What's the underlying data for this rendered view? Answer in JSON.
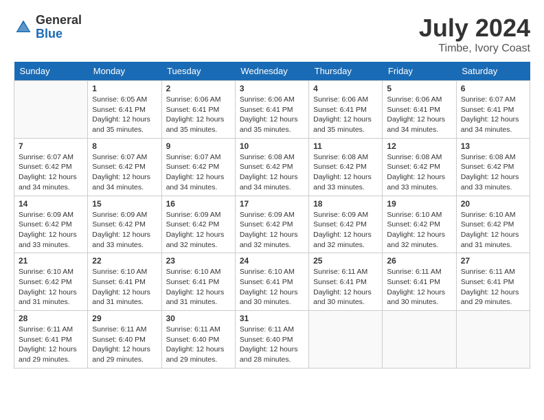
{
  "logo": {
    "general": "General",
    "blue": "Blue"
  },
  "title": {
    "month_year": "July 2024",
    "location": "Timbe, Ivory Coast"
  },
  "days_header": [
    "Sunday",
    "Monday",
    "Tuesday",
    "Wednesday",
    "Thursday",
    "Friday",
    "Saturday"
  ],
  "weeks": [
    [
      {
        "num": "",
        "info": ""
      },
      {
        "num": "1",
        "info": "Sunrise: 6:05 AM\nSunset: 6:41 PM\nDaylight: 12 hours\nand 35 minutes."
      },
      {
        "num": "2",
        "info": "Sunrise: 6:06 AM\nSunset: 6:41 PM\nDaylight: 12 hours\nand 35 minutes."
      },
      {
        "num": "3",
        "info": "Sunrise: 6:06 AM\nSunset: 6:41 PM\nDaylight: 12 hours\nand 35 minutes."
      },
      {
        "num": "4",
        "info": "Sunrise: 6:06 AM\nSunset: 6:41 PM\nDaylight: 12 hours\nand 35 minutes."
      },
      {
        "num": "5",
        "info": "Sunrise: 6:06 AM\nSunset: 6:41 PM\nDaylight: 12 hours\nand 34 minutes."
      },
      {
        "num": "6",
        "info": "Sunrise: 6:07 AM\nSunset: 6:41 PM\nDaylight: 12 hours\nand 34 minutes."
      }
    ],
    [
      {
        "num": "7",
        "info": "Sunrise: 6:07 AM\nSunset: 6:42 PM\nDaylight: 12 hours\nand 34 minutes."
      },
      {
        "num": "8",
        "info": "Sunrise: 6:07 AM\nSunset: 6:42 PM\nDaylight: 12 hours\nand 34 minutes."
      },
      {
        "num": "9",
        "info": "Sunrise: 6:07 AM\nSunset: 6:42 PM\nDaylight: 12 hours\nand 34 minutes."
      },
      {
        "num": "10",
        "info": "Sunrise: 6:08 AM\nSunset: 6:42 PM\nDaylight: 12 hours\nand 34 minutes."
      },
      {
        "num": "11",
        "info": "Sunrise: 6:08 AM\nSunset: 6:42 PM\nDaylight: 12 hours\nand 33 minutes."
      },
      {
        "num": "12",
        "info": "Sunrise: 6:08 AM\nSunset: 6:42 PM\nDaylight: 12 hours\nand 33 minutes."
      },
      {
        "num": "13",
        "info": "Sunrise: 6:08 AM\nSunset: 6:42 PM\nDaylight: 12 hours\nand 33 minutes."
      }
    ],
    [
      {
        "num": "14",
        "info": "Sunrise: 6:09 AM\nSunset: 6:42 PM\nDaylight: 12 hours\nand 33 minutes."
      },
      {
        "num": "15",
        "info": "Sunrise: 6:09 AM\nSunset: 6:42 PM\nDaylight: 12 hours\nand 33 minutes."
      },
      {
        "num": "16",
        "info": "Sunrise: 6:09 AM\nSunset: 6:42 PM\nDaylight: 12 hours\nand 32 minutes."
      },
      {
        "num": "17",
        "info": "Sunrise: 6:09 AM\nSunset: 6:42 PM\nDaylight: 12 hours\nand 32 minutes."
      },
      {
        "num": "18",
        "info": "Sunrise: 6:09 AM\nSunset: 6:42 PM\nDaylight: 12 hours\nand 32 minutes."
      },
      {
        "num": "19",
        "info": "Sunrise: 6:10 AM\nSunset: 6:42 PM\nDaylight: 12 hours\nand 32 minutes."
      },
      {
        "num": "20",
        "info": "Sunrise: 6:10 AM\nSunset: 6:42 PM\nDaylight: 12 hours\nand 31 minutes."
      }
    ],
    [
      {
        "num": "21",
        "info": "Sunrise: 6:10 AM\nSunset: 6:42 PM\nDaylight: 12 hours\nand 31 minutes."
      },
      {
        "num": "22",
        "info": "Sunrise: 6:10 AM\nSunset: 6:41 PM\nDaylight: 12 hours\nand 31 minutes."
      },
      {
        "num": "23",
        "info": "Sunrise: 6:10 AM\nSunset: 6:41 PM\nDaylight: 12 hours\nand 31 minutes."
      },
      {
        "num": "24",
        "info": "Sunrise: 6:10 AM\nSunset: 6:41 PM\nDaylight: 12 hours\nand 30 minutes."
      },
      {
        "num": "25",
        "info": "Sunrise: 6:11 AM\nSunset: 6:41 PM\nDaylight: 12 hours\nand 30 minutes."
      },
      {
        "num": "26",
        "info": "Sunrise: 6:11 AM\nSunset: 6:41 PM\nDaylight: 12 hours\nand 30 minutes."
      },
      {
        "num": "27",
        "info": "Sunrise: 6:11 AM\nSunset: 6:41 PM\nDaylight: 12 hours\nand 29 minutes."
      }
    ],
    [
      {
        "num": "28",
        "info": "Sunrise: 6:11 AM\nSunset: 6:41 PM\nDaylight: 12 hours\nand 29 minutes."
      },
      {
        "num": "29",
        "info": "Sunrise: 6:11 AM\nSunset: 6:40 PM\nDaylight: 12 hours\nand 29 minutes."
      },
      {
        "num": "30",
        "info": "Sunrise: 6:11 AM\nSunset: 6:40 PM\nDaylight: 12 hours\nand 29 minutes."
      },
      {
        "num": "31",
        "info": "Sunrise: 6:11 AM\nSunset: 6:40 PM\nDaylight: 12 hours\nand 28 minutes."
      },
      {
        "num": "",
        "info": ""
      },
      {
        "num": "",
        "info": ""
      },
      {
        "num": "",
        "info": ""
      }
    ]
  ]
}
